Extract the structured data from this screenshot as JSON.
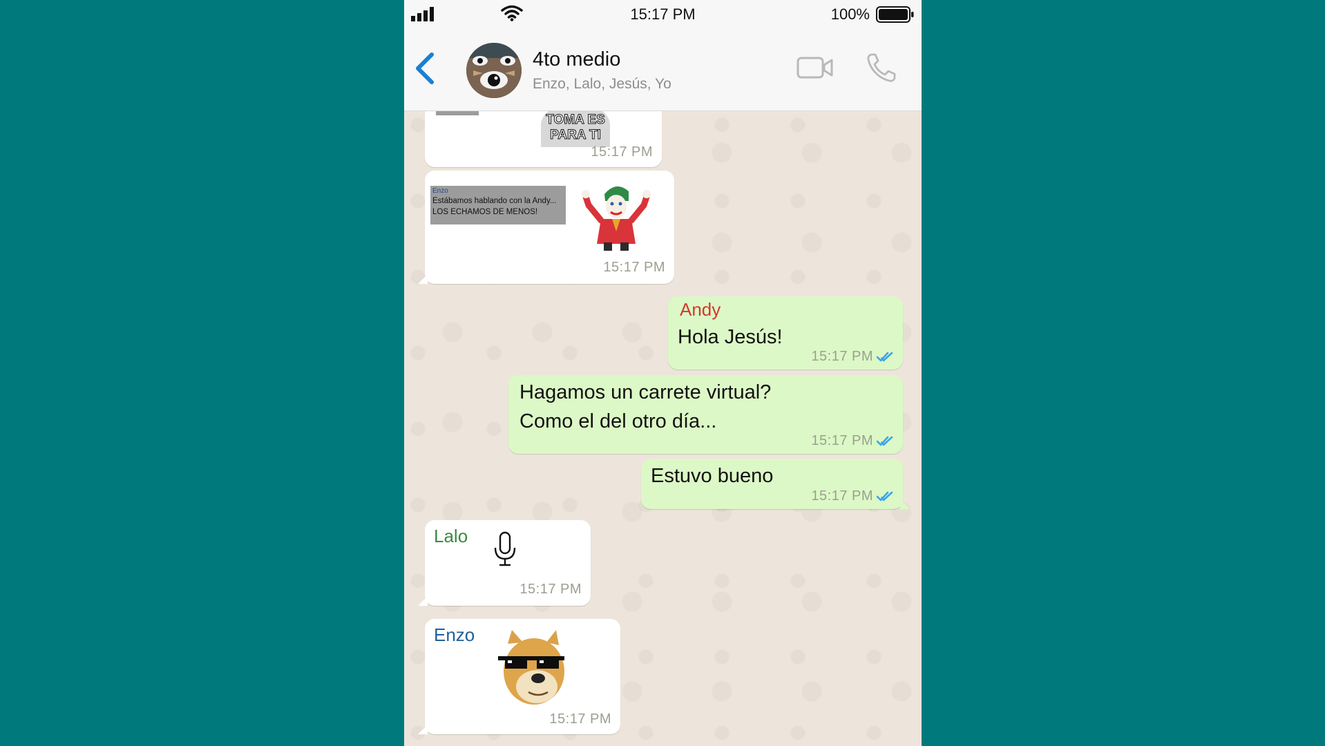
{
  "status_bar": {
    "time": "15:17 PM",
    "battery": "100%"
  },
  "header": {
    "title": "4to medio",
    "members": "Enzo, Lalo, Jesús, Yo"
  },
  "messages": [
    {
      "type": "sticker",
      "direction": "incoming",
      "sticker_caption": "TOMA ES PARA TI",
      "time": "15:17 PM"
    },
    {
      "type": "sticker",
      "direction": "incoming",
      "quote_name": "Enzo",
      "quote_text": "Estábamos hablando con la Andy... LOS ECHAMOS DE MENOS!",
      "sticker_icon": "joker-sticker",
      "time": "15:17 PM"
    },
    {
      "type": "text",
      "direction": "outgoing",
      "sender": "Andy",
      "text": "Hola Jesús!",
      "time": "15:17 PM"
    },
    {
      "type": "text",
      "direction": "outgoing",
      "lines": [
        "Hagamos un carrete virtual?",
        "Como el del otro día..."
      ],
      "time": "15:17 PM"
    },
    {
      "type": "text",
      "direction": "outgoing",
      "text": "Estuvo bueno",
      "time": "15:17 PM"
    },
    {
      "type": "audio",
      "direction": "incoming",
      "sender": "Lalo",
      "icon": "microphone-icon",
      "time": "15:17 PM"
    },
    {
      "type": "sticker",
      "direction": "incoming",
      "sender": "Enzo",
      "sticker_icon": "doge-sunglasses-sticker",
      "time": "15:17 PM"
    }
  ],
  "colors": {
    "background": "#00797c",
    "outgoing_bubble": "#dcf8c6",
    "incoming_bubble": "#ffffff",
    "accent_blue": "#1a7fd4",
    "sender_andy": "#d2392f",
    "sender_lalo": "#3a8a44",
    "sender_enzo": "#1f5f9a"
  }
}
